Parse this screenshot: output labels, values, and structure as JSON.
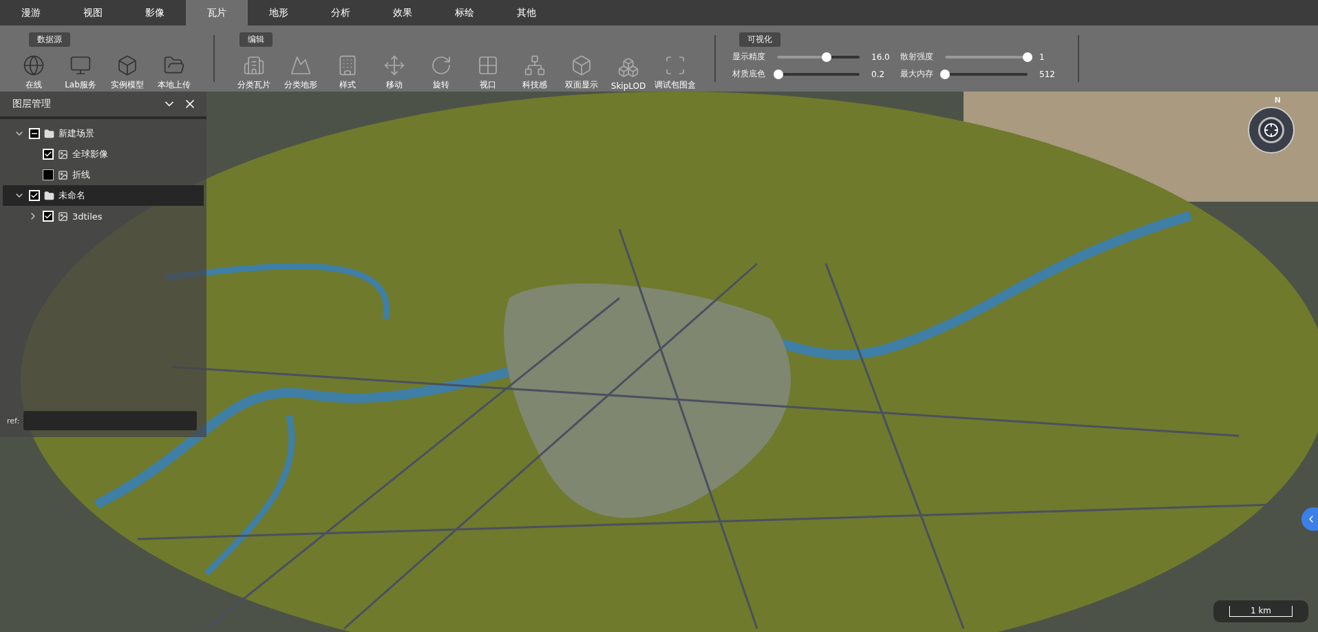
{
  "menu": [
    {
      "label": "漫游",
      "selected": false
    },
    {
      "label": "视图",
      "selected": false
    },
    {
      "label": "影像",
      "selected": false
    },
    {
      "label": "瓦片",
      "selected": true
    },
    {
      "label": "地形",
      "selected": false
    },
    {
      "label": "分析",
      "selected": false
    },
    {
      "label": "效果",
      "selected": false
    },
    {
      "label": "标绘",
      "selected": false
    },
    {
      "label": "其他",
      "selected": false
    }
  ],
  "toolbar": {
    "groups": [
      {
        "title": "数据源",
        "buttons": [
          "在线",
          "Lab服务",
          "实例模型",
          "本地上传"
        ]
      },
      {
        "title": "编辑",
        "buttons": [
          "分类瓦片",
          "分类地形",
          "样式",
          "移动",
          "旋转",
          "视口",
          "科技感",
          "双面显示",
          "SkipLOD",
          "调试包围盒"
        ]
      }
    ],
    "visual": {
      "title": "可视化",
      "sliders": [
        {
          "label": "显示精度",
          "level": 0.6,
          "reading": "16.0"
        },
        {
          "label": "散射强度",
          "level": 1,
          "reading": "1"
        },
        {
          "label": "材质底色",
          "level": 0.02,
          "reading": "0.2"
        },
        {
          "label": "最大内存",
          "level": 0,
          "reading": "512"
        }
      ]
    }
  },
  "layer_panel": {
    "title": "图层管理",
    "tree": [
      {
        "label": "新建场景",
        "kind": "folder",
        "checked": true,
        "partial": true,
        "expanded": true,
        "selected": false,
        "children": [
          {
            "label": "全球影像",
            "kind": "layer",
            "checked": true,
            "partial": false,
            "selected": false
          },
          {
            "label": "折线",
            "kind": "layer",
            "checked": false,
            "partial": false,
            "selected": false
          }
        ]
      },
      {
        "label": "未命名",
        "kind": "folder",
        "checked": true,
        "partial": false,
        "expanded": true,
        "selected": true,
        "children": [
          {
            "label": "3dtiles",
            "kind": "layer",
            "checked": true,
            "partial": false,
            "expanded": false,
            "selected": false
          }
        ]
      }
    ],
    "ref_label": "ref:"
  },
  "map": {
    "compass_north": "N",
    "scale": "1 km"
  }
}
